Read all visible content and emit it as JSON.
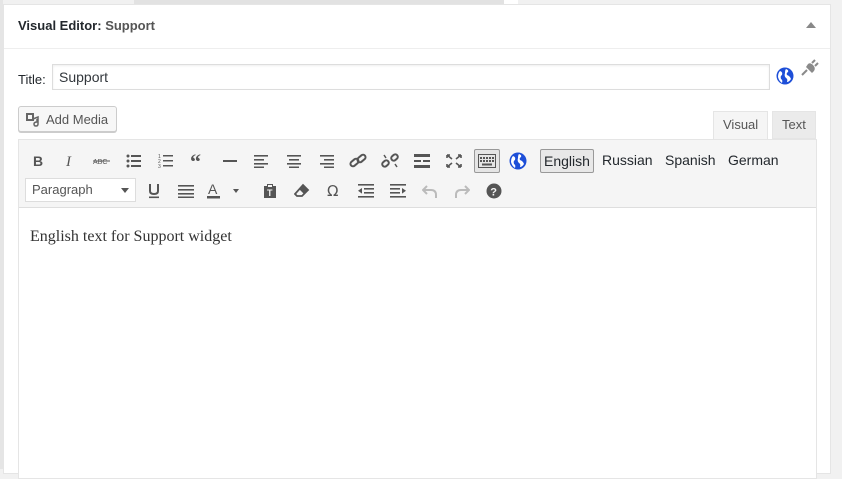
{
  "panel": {
    "title_prefix": "Visual Editor:",
    "title_name": "Support"
  },
  "title_field": {
    "label": "Title:",
    "value": "Support"
  },
  "icons": {
    "globe": "globe-icon",
    "plug": "plug-icon",
    "add_media": "add-media-icon"
  },
  "add_media": {
    "label": "Add Media"
  },
  "editor_tabs": {
    "visual": "Visual",
    "text": "Text"
  },
  "toolbar": {
    "languages": [
      "English",
      "Russian",
      "Spanish",
      "German"
    ],
    "selected_language": "English",
    "format_value": "Paragraph"
  },
  "content": {
    "text": "English text for Support widget"
  },
  "colors": {
    "accent_globe": "#1e4fd8",
    "toolbar_bg": "#f5f5f5",
    "icon": "#555555"
  }
}
